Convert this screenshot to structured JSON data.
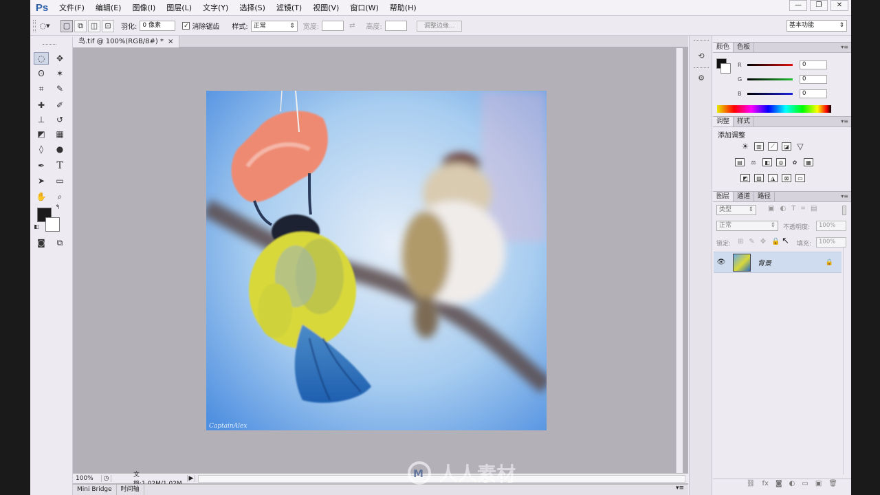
{
  "app": {
    "logo": "Ps"
  },
  "menu": [
    "文件(F)",
    "编辑(E)",
    "图像(I)",
    "图层(L)",
    "文字(Y)",
    "选择(S)",
    "滤镜(T)",
    "视图(V)",
    "窗口(W)",
    "帮助(H)"
  ],
  "window_controls": {
    "minimize": "—",
    "restore": "❐",
    "close": "✕"
  },
  "options": {
    "feather_label": "羽化:",
    "feather_value": "0 像素",
    "antialias_label": "消除锯齿",
    "antialias_checked": "✓",
    "style_label": "样式:",
    "style_value": "正常",
    "width_label": "宽度:",
    "height_label": "高度:",
    "refine_edge": "调整边缘...",
    "workspace": "基本功能"
  },
  "document": {
    "tab_title": "鸟.tif @ 100%(RGB/8#) *",
    "tab_close": "×",
    "zoom": "100%",
    "doc_info": "文档:1.02M/1.02M",
    "signature": "CaptainAlex"
  },
  "bottom_tabs": [
    "Mini Bridge",
    "时间轴"
  ],
  "color_panel": {
    "tabs": [
      "颜色",
      "色板"
    ],
    "channels": [
      {
        "label": "R",
        "value": "0",
        "color": "#d0101a"
      },
      {
        "label": "G",
        "value": "0",
        "color": "#1a9a2a"
      },
      {
        "label": "B",
        "value": "0",
        "color": "#1a22c0"
      }
    ]
  },
  "adjustments_panel": {
    "tabs": [
      "调整",
      "样式"
    ],
    "title": "添加调整"
  },
  "layers_panel": {
    "tabs": [
      "图层",
      "通道",
      "路径"
    ],
    "filter_label": "类型",
    "blend_mode": "正常",
    "opacity_label": "不透明度:",
    "opacity_value": "100%",
    "lock_label": "锁定:",
    "fill_label": "填充:",
    "fill_value": "100%",
    "layers": [
      {
        "name": "背景",
        "visible_icon": "👁",
        "lock_icon": "🔒"
      }
    ],
    "footer_icons": [
      "⛓",
      "fx",
      "◙",
      "◐",
      "▭",
      "▣",
      "🗑"
    ]
  },
  "watermark": {
    "text": "人人素材"
  },
  "colors": {
    "accent": "#2d5fa8",
    "canvas_bg": "#b3b0b8",
    "panel_bg": "#eeeaf2",
    "layer_selected": "#cfdcef"
  }
}
